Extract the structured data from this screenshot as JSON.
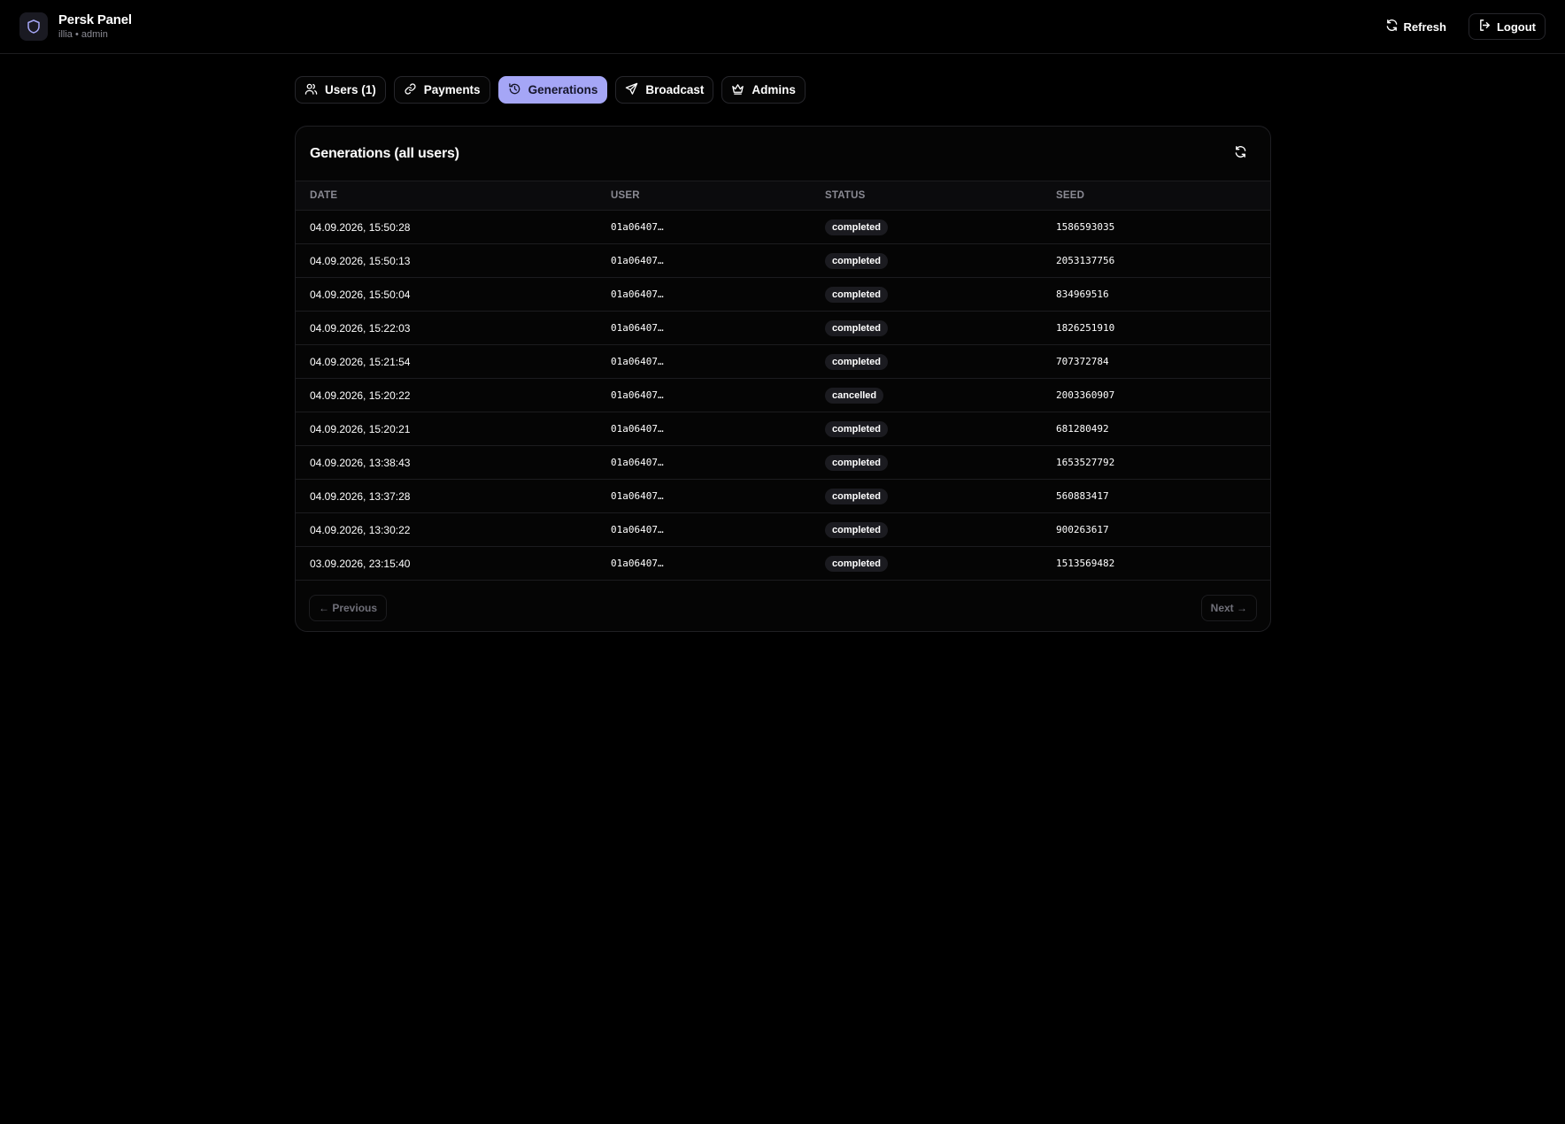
{
  "app": {
    "title": "Persk Panel",
    "subtitle": "illia • admin"
  },
  "header": {
    "refresh_label": "Refresh",
    "logout_label": "Logout"
  },
  "tabs": [
    {
      "label": "Users (1)",
      "icon": "users-icon",
      "active": false
    },
    {
      "label": "Payments",
      "icon": "link-icon",
      "active": false
    },
    {
      "label": "Generations",
      "icon": "history-icon",
      "active": true
    },
    {
      "label": "Broadcast",
      "icon": "send-icon",
      "active": false
    },
    {
      "label": "Admins",
      "icon": "crown-icon",
      "active": false
    }
  ],
  "generations": {
    "title": "Generations (all users)",
    "columns": {
      "date": "DATE",
      "user": "USER",
      "status": "STATUS",
      "seed": "SEED"
    },
    "rows": [
      {
        "date": "04.09.2026, 15:50:28",
        "user": "01a06407…",
        "status": "completed",
        "seed": "1586593035"
      },
      {
        "date": "04.09.2026, 15:50:13",
        "user": "01a06407…",
        "status": "completed",
        "seed": "2053137756"
      },
      {
        "date": "04.09.2026, 15:50:04",
        "user": "01a06407…",
        "status": "completed",
        "seed": "834969516"
      },
      {
        "date": "04.09.2026, 15:22:03",
        "user": "01a06407…",
        "status": "completed",
        "seed": "1826251910"
      },
      {
        "date": "04.09.2026, 15:21:54",
        "user": "01a06407…",
        "status": "completed",
        "seed": "707372784"
      },
      {
        "date": "04.09.2026, 15:20:22",
        "user": "01a06407…",
        "status": "cancelled",
        "seed": "2003360907"
      },
      {
        "date": "04.09.2026, 15:20:21",
        "user": "01a06407…",
        "status": "completed",
        "seed": "681280492"
      },
      {
        "date": "04.09.2026, 13:38:43",
        "user": "01a06407…",
        "status": "completed",
        "seed": "1653527792"
      },
      {
        "date": "04.09.2026, 13:37:28",
        "user": "01a06407…",
        "status": "completed",
        "seed": "560883417"
      },
      {
        "date": "04.09.2026, 13:30:22",
        "user": "01a06407…",
        "status": "completed",
        "seed": "900263617"
      },
      {
        "date": "03.09.2026, 23:15:40",
        "user": "01a06407…",
        "status": "completed",
        "seed": "1513569482"
      }
    ]
  },
  "pagination": {
    "previous_label": "← Previous",
    "next_label": "Next →"
  },
  "colors": {
    "accent": "#a5a6f6",
    "background": "#000000",
    "badge": "#1b1b20"
  }
}
